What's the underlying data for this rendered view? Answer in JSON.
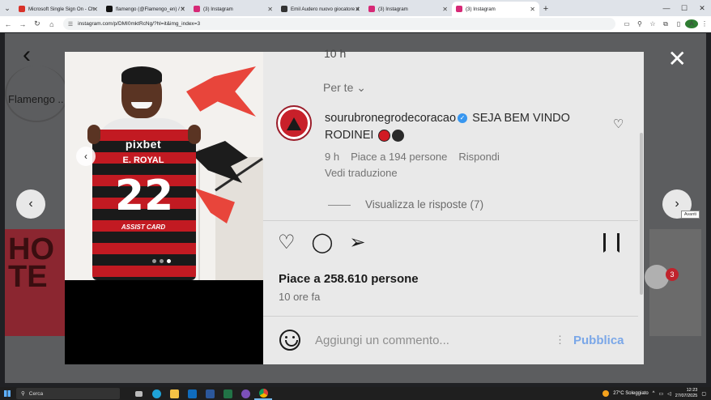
{
  "browser": {
    "tabs": [
      {
        "title": "Microsoft Single Sign On - Ch",
        "color": "#d8322a",
        "active": false
      },
      {
        "title": "flamengo (@Flamengo_en) / X",
        "color": "#111111",
        "active": false
      },
      {
        "title": "(3) Instagram",
        "color": "#d62976",
        "active": false
      },
      {
        "title": "Emil Audero nuovo giocatore d",
        "color": "#333333",
        "active": false
      },
      {
        "title": "(3) Instagram",
        "color": "#d62976",
        "active": false
      },
      {
        "title": "(3) Instagram",
        "color": "#d62976",
        "active": true
      }
    ],
    "url": "instagram.com/p/DMI0mktRcNg/?hl=it&img_index=3",
    "profile_initial": "A"
  },
  "background": {
    "label": "Flamengo ..",
    "tile_text": "HO\nTE",
    "notif_count": "3",
    "next_tooltip": "Avanti"
  },
  "post": {
    "jersey": {
      "brand": "pixbet",
      "name": "E. ROYAL",
      "number": "22",
      "sponsor": "ASSIST CARD"
    },
    "partial_time": "10 h",
    "translate_hint": "Per te ⌄",
    "comment": {
      "user": "sourubronegrodecoracao",
      "text": "SEJA BEM VINDO RODINEI",
      "time": "9 h",
      "likes": "Piace a 194 persone",
      "reply": "Rispondi",
      "see_translation": "Vedi traduzione"
    },
    "replies": "Visualizza le risposte (7)",
    "likes": "Piace a 258.610 persone",
    "time_ago": "10 ore fa",
    "composer": {
      "placeholder": "Aggiungi un commento...",
      "publish": "Pubblica"
    }
  },
  "taskbar": {
    "search": "Cerca",
    "weather": "27°C  Soleggiato",
    "time": "12:23",
    "date": "27/07/2025"
  }
}
